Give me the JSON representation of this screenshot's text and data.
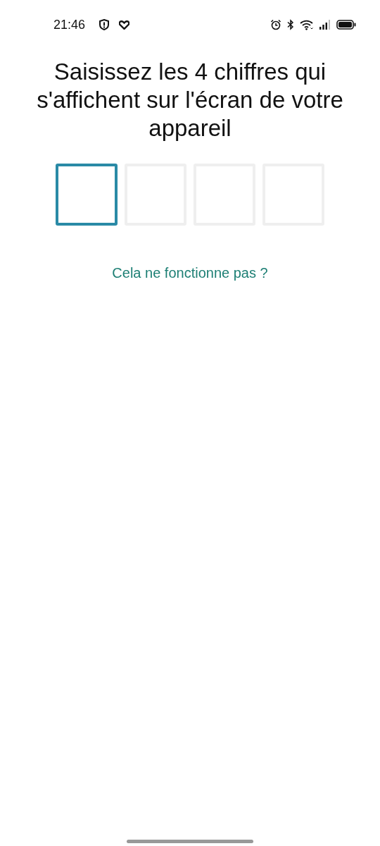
{
  "status_bar": {
    "time": "21:46"
  },
  "title": "Saisissez les 4 chiffres qui s'affichent sur l'écran de votre appareil",
  "code_digits": [
    {
      "selected": true
    },
    {
      "selected": false
    },
    {
      "selected": false
    },
    {
      "selected": false
    }
  ],
  "help_link": "Cela ne fonctionne pas ?"
}
